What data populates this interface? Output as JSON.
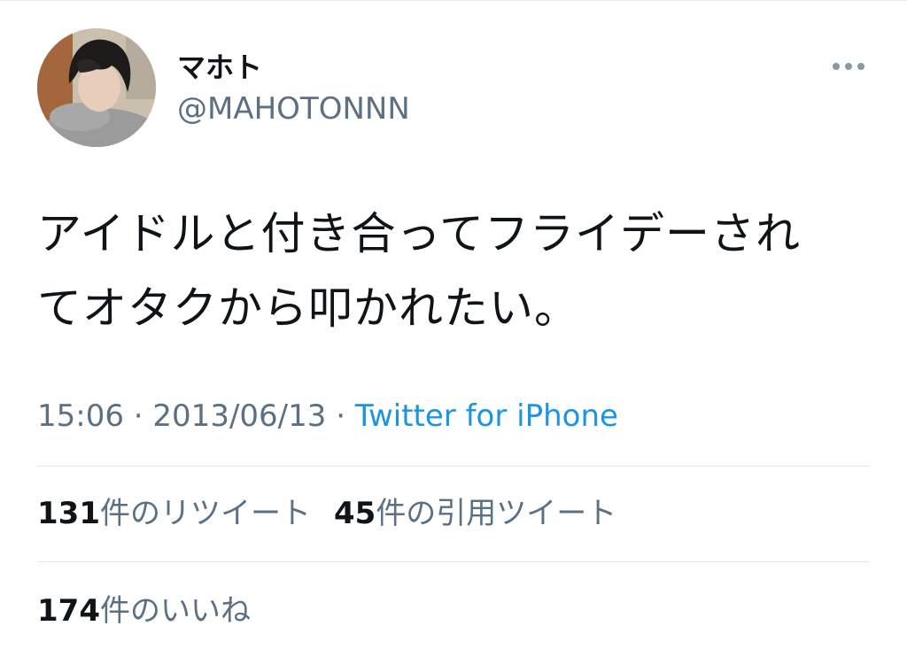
{
  "user": {
    "display_name": "マホト",
    "handle": "@MAHOTONNN"
  },
  "tweet": {
    "text_line1": "アイドルと付き合ってフライデーされ",
    "text_line2": "てオタクから叩かれたい。",
    "time": "15:06",
    "separator": "·",
    "date": "2013/06/13",
    "source": "Twitter for iPhone"
  },
  "stats": {
    "retweets_count": "131",
    "retweets_label": "件のリツイート",
    "quotes_count": "45",
    "quotes_label": "件の引用ツイート",
    "likes_count": "174",
    "likes_label": "件のいいね"
  },
  "icons": {
    "more": "more-horizontal-icon"
  },
  "colors": {
    "text_primary": "#0f1419",
    "text_secondary": "#5b7083",
    "link": "#1b95e0",
    "divider": "#e1e8ed"
  }
}
